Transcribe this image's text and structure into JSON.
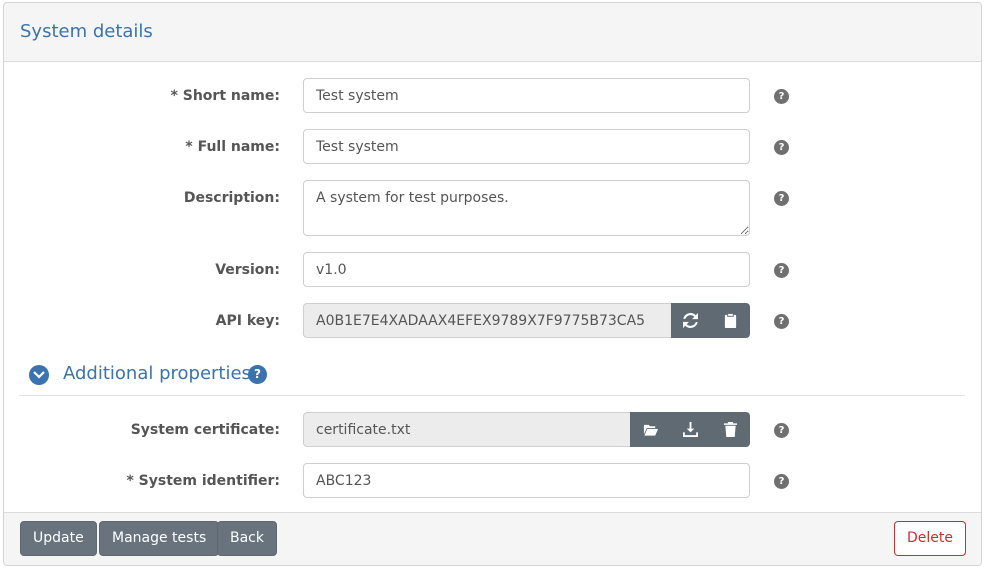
{
  "panel": {
    "title": "System details"
  },
  "fields": {
    "short_name": {
      "label": "* Short name:",
      "value": "Test system"
    },
    "full_name": {
      "label": "* Full name:",
      "value": "Test system"
    },
    "description": {
      "label": "Description:",
      "value": "A system for test purposes."
    },
    "version": {
      "label": "Version:",
      "value": "v1.0"
    },
    "api_key": {
      "label": "API key:",
      "value": "A0B1E7E4XADAAX4EFEX9789X7F9775B73CA5"
    },
    "system_certificate": {
      "label": "System certificate:",
      "value": "certificate.txt"
    },
    "system_identifier": {
      "label": "* System identifier:",
      "value": "ABC123"
    }
  },
  "additional_section": {
    "title": "Additional properties"
  },
  "help_glyph": "?",
  "footer": {
    "update_label": "Update",
    "manage_tests_label": "Manage tests",
    "back_label": "Back",
    "delete_label": "Delete"
  },
  "icons": {
    "api_key_actions": [
      "refresh-icon",
      "clipboard-icon"
    ],
    "certificate_actions": [
      "folder-open-icon",
      "download-icon",
      "trash-icon"
    ],
    "section_toggle": "chevron-down-icon",
    "help": "question-circle-icon"
  },
  "colors": {
    "accent": "#3a73b0",
    "button": "#68737d",
    "danger": "#c9302c",
    "readonly_field": "#ececec"
  }
}
